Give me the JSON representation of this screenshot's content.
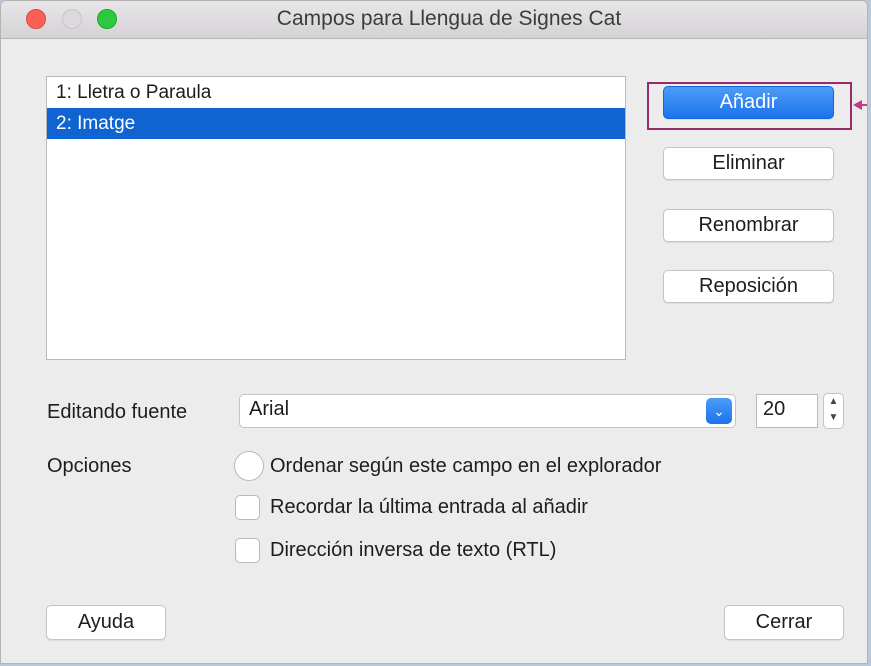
{
  "window": {
    "title": "Campos para Llengua de Signes Cat"
  },
  "fields_list": {
    "items": [
      {
        "label": "1: Lletra o Paraula",
        "selected": false
      },
      {
        "label": "2: Imatge",
        "selected": true
      }
    ]
  },
  "actions": {
    "add_label": "Añadir",
    "delete_label": "Eliminar",
    "rename_label": "Renombrar",
    "reposition_label": "Reposición"
  },
  "font_editor": {
    "label": "Editando fuente",
    "font_value": "Arial",
    "size_value": "20"
  },
  "options": {
    "label": "Opciones",
    "sort_by_field": {
      "label": "Ordenar según este campo en el explorador",
      "checked": false
    },
    "remember_last": {
      "label": "Recordar la última entrada al añadir",
      "checked": false
    },
    "rtl": {
      "label": "Dirección inversa de texto (RTL)",
      "checked": false
    }
  },
  "footer": {
    "help_label": "Ayuda",
    "close_label": "Cerrar"
  },
  "colors": {
    "accent": "#1a73ec",
    "selection": "#0f64d2",
    "annotation": "#9b2a6b"
  }
}
